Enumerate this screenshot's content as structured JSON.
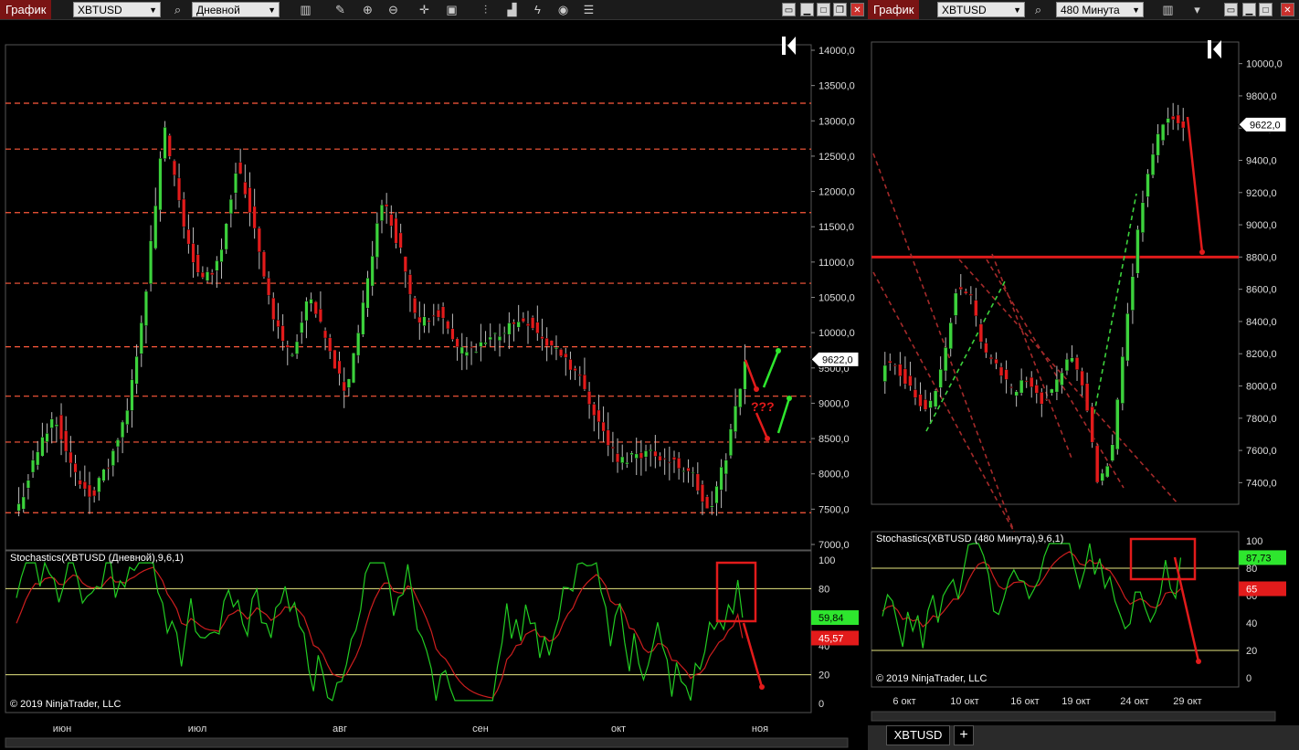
{
  "left": {
    "title": "График",
    "symbol": "XBTUSD",
    "period": "Дневной",
    "price_ticks": [
      "14000,0",
      "13500,0",
      "13000,0",
      "12500,0",
      "12000,0",
      "11500,0",
      "11000,0",
      "10500,0",
      "10000,0",
      "9500,0",
      "9000,0",
      "8500,0",
      "8000,0",
      "7500,0",
      "7000,0"
    ],
    "price_tag": "9622,0",
    "stoch_label": "Stochastics(XBTUSD (Дневной),9,6,1)",
    "stoch_ticks": [
      "100",
      "80",
      "60",
      "40",
      "20",
      "0"
    ],
    "stoch_k": "59,84",
    "stoch_d": "45,57",
    "copyright": "© 2019 NinjaTrader, LLC",
    "x_ticks": [
      "июн",
      "июл",
      "авг",
      "сен",
      "окт",
      "ноя"
    ],
    "annotation": "???"
  },
  "right": {
    "title": "График",
    "symbol": "XBTUSD",
    "period": "480 Минута",
    "price_ticks": [
      "10000,0",
      "9800,0",
      "9600,0",
      "9400,0",
      "9200,0",
      "9000,0",
      "8800,0",
      "8600,0",
      "8400,0",
      "8200,0",
      "8000,0",
      "7800,0",
      "7600,0",
      "7400,0"
    ],
    "price_tag": "9622,0",
    "stoch_label": "Stochastics(XBTUSD (480 Минута),9,6,1)",
    "stoch_ticks": [
      "100",
      "80",
      "60",
      "40",
      "20",
      "0"
    ],
    "stoch_k": "87,73",
    "stoch_d": "65",
    "copyright": "© 2019 NinjaTrader, LLC",
    "x_ticks": [
      "6 окт",
      "10 окт",
      "16 окт",
      "19 окт",
      "24 окт",
      "29 окт"
    ],
    "tab": "XBTUSD",
    "add_tab": "+"
  },
  "colors": {
    "up": "#3cd23c",
    "down": "#e21b1b",
    "level": "#ff5a3c",
    "k": "#22cc22",
    "d": "#cc1e1e",
    "band": "#e6e680",
    "titlebar": "#7a1414"
  },
  "icons": [
    "bar-chart-icon",
    "pencil-icon",
    "zoom-in-icon",
    "zoom-out-icon",
    "crosshair-icon",
    "data-box-icon",
    "bar-style-icon",
    "step-icon",
    "drawing-icon",
    "refresh-icon",
    "properties-icon"
  ],
  "chart_data": [
    {
      "type": "candlestick",
      "title": "XBTUSD (Дневной)",
      "ylim": [
        7000,
        14000
      ],
      "x_ticks": [
        "июн",
        "июл",
        "авг",
        "сен",
        "окт",
        "ноя"
      ],
      "last_price": 9622,
      "horizontal_levels": [
        13250,
        12600,
        11700,
        10700,
        9800,
        9100,
        8450,
        7450
      ],
      "close_approx": [
        7550,
        8300,
        8850,
        8000,
        7700,
        8150,
        8900,
        10600,
        12900,
        11600,
        10700,
        11000,
        12400,
        11500,
        10200,
        9650,
        10500,
        9800,
        9150,
        10400,
        11900,
        11200,
        10050,
        10350,
        9800,
        9700,
        9900,
        10100,
        10200,
        9850,
        9700,
        9300,
        8700,
        8150,
        8300,
        8300,
        8150,
        8050,
        7400,
        8300,
        9622
      ],
      "stochastic": {
        "k_last": 59.84,
        "d_last": 45.57,
        "levels": [
          20,
          80
        ]
      }
    },
    {
      "type": "candlestick",
      "title": "XBTUSD (480 Минута)",
      "ylim": [
        7300,
        10100
      ],
      "x_ticks": [
        "6 окт",
        "10 окт",
        "16 окт",
        "19 окт",
        "24 окт",
        "29 окт"
      ],
      "last_price": 9622,
      "horizontal_levels": [
        8800
      ],
      "close_approx": [
        8150,
        8100,
        7950,
        7850,
        8100,
        8600,
        8550,
        8200,
        8100,
        7950,
        8050,
        7900,
        8000,
        8200,
        8000,
        7400,
        7600,
        8400,
        9100,
        9500,
        9700,
        9600
      ],
      "stochastic": {
        "k_last": 87.73,
        "d_last": 65,
        "levels": [
          20,
          80
        ]
      }
    }
  ]
}
